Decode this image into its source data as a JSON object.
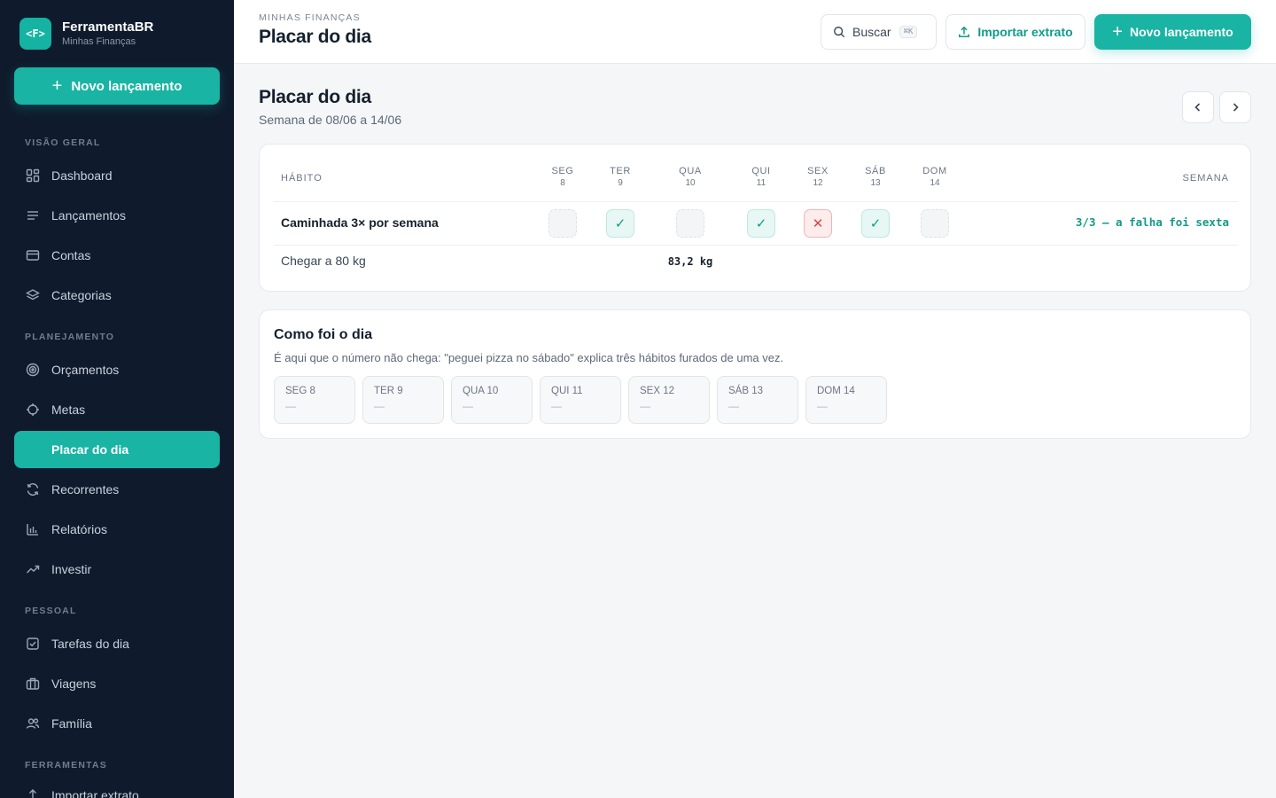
{
  "brand": {
    "logo": "<F>",
    "name": "FerramentaBR",
    "subtitle": "Minhas Finanças"
  },
  "sidebar": {
    "new_button": "Novo lançamento",
    "sections": [
      {
        "label": "VISÃO GERAL"
      },
      {
        "label": "PLANEJAMENTO"
      },
      {
        "label": "PESSOAL"
      },
      {
        "label": "FERRAMENTAS"
      }
    ],
    "items": [
      {
        "label": "Dashboard",
        "icon": "grid-icon"
      },
      {
        "label": "Lançamentos",
        "icon": "list-icon"
      },
      {
        "label": "Contas",
        "icon": "card-icon"
      },
      {
        "label": "Categorias",
        "icon": "layers-icon"
      },
      {
        "label": "Orçamentos",
        "icon": "target-icon"
      },
      {
        "label": "Metas",
        "icon": "crosshair-icon"
      },
      {
        "label": "Placar do dia",
        "icon": "",
        "active": true
      },
      {
        "label": "Recorrentes",
        "icon": "refresh-icon"
      },
      {
        "label": "Relatórios",
        "icon": "bar-chart-icon"
      },
      {
        "label": "Investir",
        "icon": "trending-up-icon"
      },
      {
        "label": "Tarefas do dia",
        "icon": "check-square-icon"
      },
      {
        "label": "Viagens",
        "icon": "briefcase-icon"
      },
      {
        "label": "Família",
        "icon": "users-icon"
      },
      {
        "label": "Importar extrato",
        "icon": "upload-icon"
      }
    ]
  },
  "topbar": {
    "breadcrumb": "MINHAS FINANÇAS",
    "title": "Placar do dia",
    "search_label": "Buscar",
    "search_shortcut": "⌘K",
    "import_label": "Importar extrato",
    "new_label": "Novo lançamento"
  },
  "page": {
    "title": "Placar do dia",
    "subtitle": "Semana de 08/06 a 14/06"
  },
  "scoreboard": {
    "habit_header": "HÁBITO",
    "week_header": "SEMANA",
    "days": [
      {
        "name": "SEG",
        "num": "8"
      },
      {
        "name": "TER",
        "num": "9"
      },
      {
        "name": "QUA",
        "num": "10"
      },
      {
        "name": "QUI",
        "num": "11"
      },
      {
        "name": "SEX",
        "num": "12"
      },
      {
        "name": "SÁB",
        "num": "13"
      },
      {
        "name": "DOM",
        "num": "14"
      }
    ],
    "habits": [
      {
        "name": "Caminhada 3× por semana",
        "status": [
          "empty",
          "ok",
          "empty",
          "ok",
          "fail",
          "ok",
          "empty"
        ],
        "summary": "3/3 — a falha foi sexta"
      }
    ],
    "goals": [
      {
        "name": "Chegar a 80 kg",
        "value": "83,2 kg",
        "day_index": 2
      }
    ],
    "status_colors": {
      "ok": "#139a8b",
      "fail": "#d64545"
    }
  },
  "day_notes": {
    "title": "Como foi o dia",
    "subtitle": "É aqui que o número não chega: \"peguei pizza no sábado\" explica três hábitos furados de uma vez.",
    "boxes": [
      {
        "label": "SEG 8",
        "value": "—"
      },
      {
        "label": "TER 9",
        "value": "—"
      },
      {
        "label": "QUA 10",
        "value": "—"
      },
      {
        "label": "QUI 11",
        "value": "—"
      },
      {
        "label": "SEX 12",
        "value": "—"
      },
      {
        "label": "SÁB 13",
        "value": "—"
      },
      {
        "label": "DOM 14",
        "value": "—"
      }
    ]
  },
  "colors": {
    "sidebar_bg": "#0f1b2d",
    "accent": "#19b4a3"
  }
}
